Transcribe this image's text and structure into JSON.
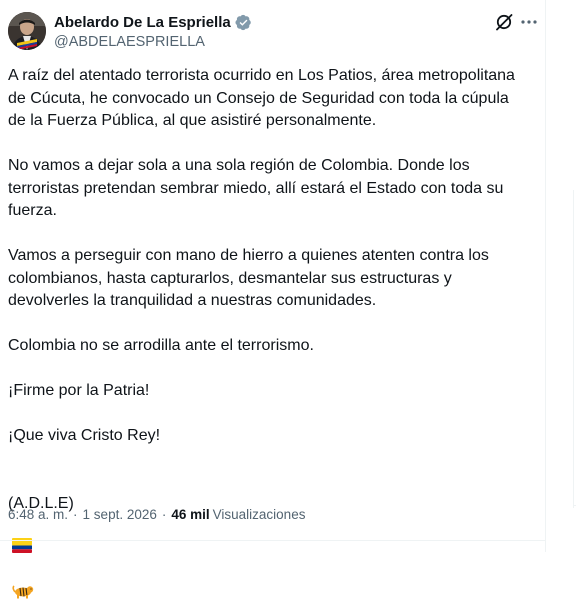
{
  "author": {
    "display_name": "Abelardo De La Espriella",
    "handle": "@ABDELAESPRIELLA",
    "verified": true
  },
  "tweet": {
    "paragraphs": [
      "A raíz del atentado terrorista ocurrido en Los Patios, área metropolitana\nde Cúcuta, he convocado un Consejo de Seguridad con toda la cúpula\nde la Fuerza Pública, al que asistiré personalmente.",
      "No vamos a dejar sola a una sola región de Colombia. Donde los\nterroristas pretendan sembrar miedo, allí estará el Estado con toda su\nfuerza.",
      "Vamos a perseguir con mano de hierro a quienes atenten contra los\ncolombianos, hasta capturarlos, desmantelar sus estructuras y\ndevolverles la tranquilidad a nuestras comunidades.",
      "Colombia no se arrodilla ante el terrorismo.",
      "¡Firme por la Patria!",
      "¡Que viva Cristo Rey!"
    ],
    "signature": "(A.D.L.E)",
    "emojis": [
      "colombia-flag-emoji",
      "tiger-emoji"
    ]
  },
  "meta": {
    "time": "6:48 a. m.",
    "separator": "·",
    "date": "1 sept. 2026",
    "views_count": "46 mil",
    "views_label": "Visualizaciones"
  },
  "icons": {
    "grok": "grok-icon",
    "more": "more-icon",
    "verified": "verified-badge-icon"
  },
  "colors": {
    "text": "#0f1419",
    "secondary": "#536471",
    "verified_badge": "#829aab",
    "border": "#eff3f4"
  }
}
